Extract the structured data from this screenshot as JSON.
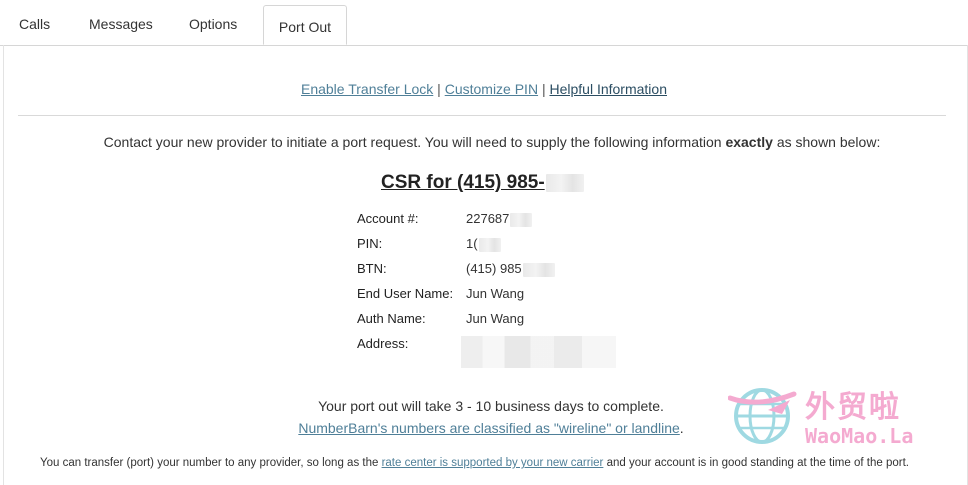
{
  "tabs": [
    {
      "label": "Calls"
    },
    {
      "label": "Messages"
    },
    {
      "label": "Options"
    },
    {
      "label": "Port Out",
      "active": true
    }
  ],
  "links": {
    "enable_transfer_lock": "Enable Transfer Lock",
    "separator": "|",
    "customize_pin": "Customize PIN",
    "helpful_information": "Helpful Information"
  },
  "instructions": {
    "before": "Contact your new provider to initiate a port request. You will need to supply the following information ",
    "emphasis": "exactly",
    "after": " as shown below:"
  },
  "csr": {
    "heading": "CSR for (415) 985-"
  },
  "fields": [
    {
      "label": "Account #:",
      "value": "227687"
    },
    {
      "label": "PIN:",
      "value": "1("
    },
    {
      "label": "BTN:",
      "value": "(415) 985"
    },
    {
      "label": "End User Name:",
      "value": "Jun Wang"
    },
    {
      "label": "Auth Name:",
      "value": "Jun Wang"
    },
    {
      "label": "Address:",
      "value": ""
    }
  ],
  "port_time": "Your port out will take 3 - 10 business days to complete.",
  "wireline": {
    "link": "NumberBarn's numbers are classified as \"wireline\" or landline",
    "after": "."
  },
  "footer": {
    "before": "You can transfer (port) your number to any provider, so long as the ",
    "link": "rate center is supported by your new carrier",
    "after": " and your account is in good standing at the time of the port."
  },
  "watermark": {
    "cn": "外贸啦",
    "en": "WaoMao.La"
  },
  "colors": {
    "link": "#4f7f98",
    "text": "#333333",
    "border": "#d6d6d6",
    "watermark": "#f39cc8"
  }
}
